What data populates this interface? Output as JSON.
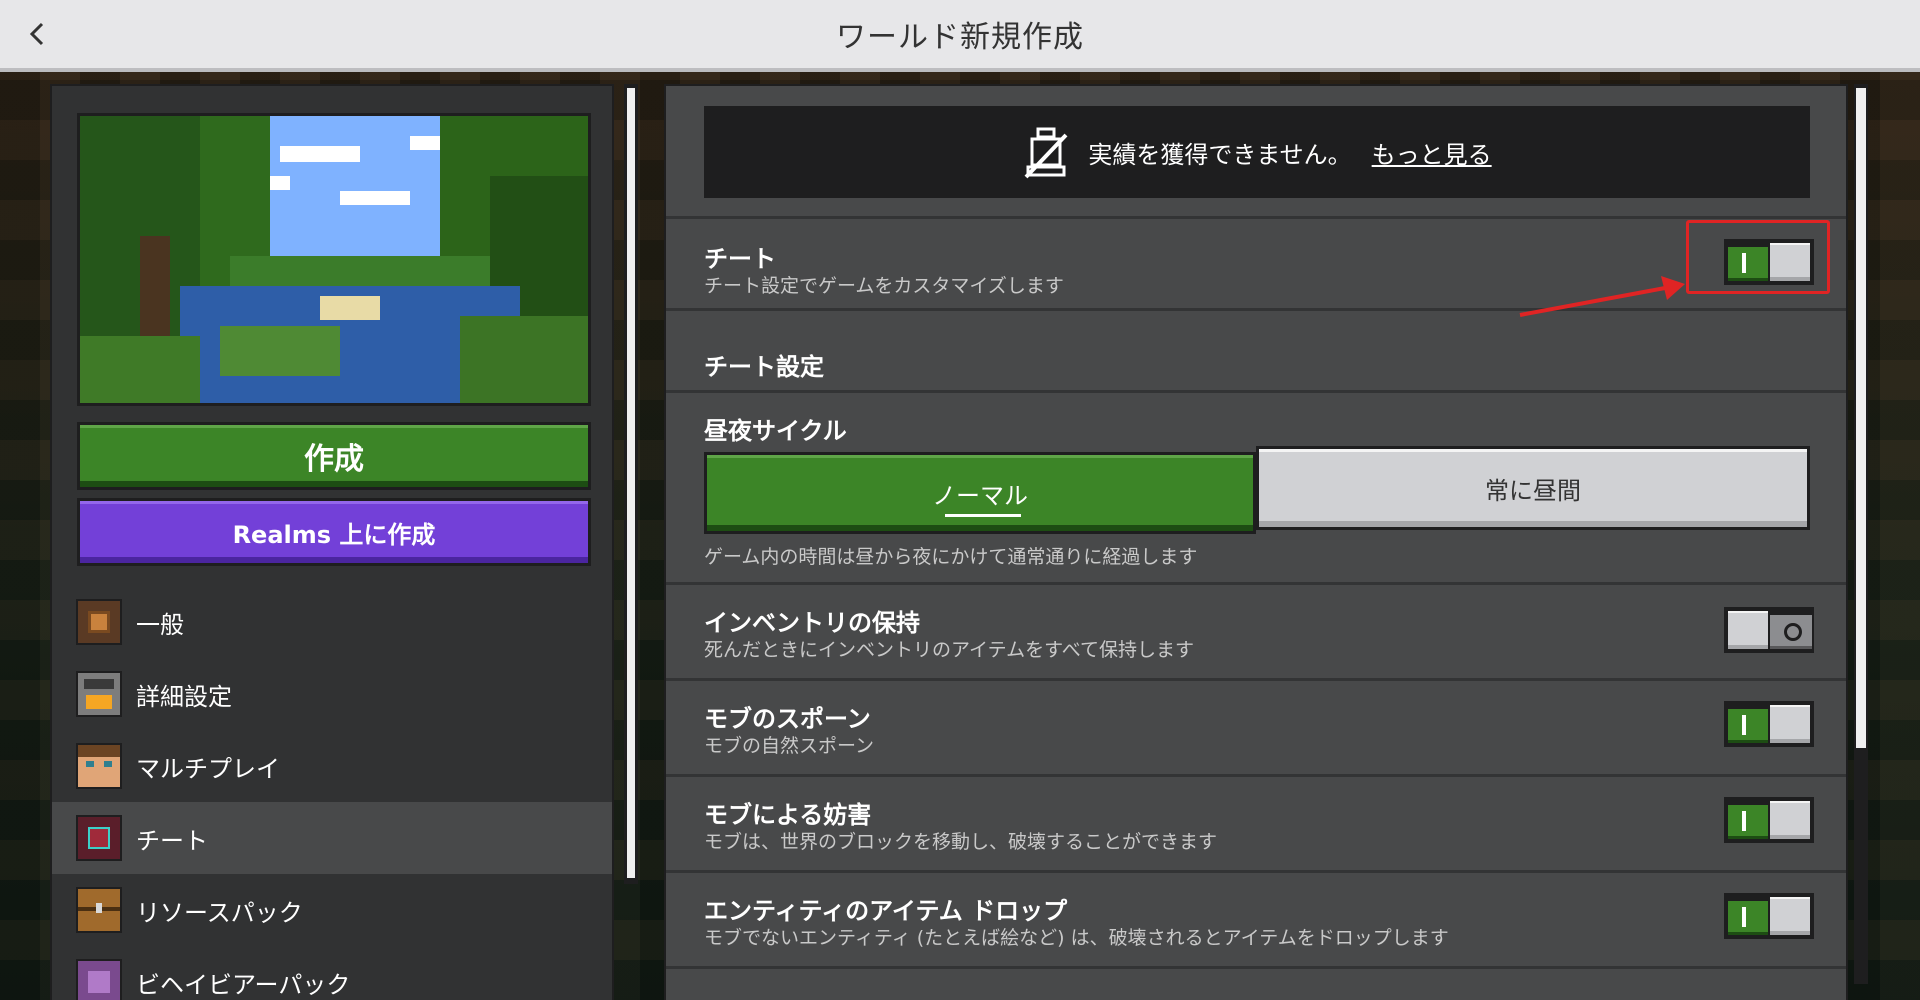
{
  "titlebar": {
    "title": "ワールド新規作成",
    "back_icon": "chevron-left-icon"
  },
  "left": {
    "create_label": "作成",
    "realms_label": "Realms 上に作成",
    "nav": [
      {
        "label": "一般",
        "icon": "gear-icon",
        "active": false
      },
      {
        "label": "詳細設定",
        "icon": "furnace-icon",
        "active": false
      },
      {
        "label": "マルチプレイ",
        "icon": "player-face-icon",
        "active": false
      },
      {
        "label": "チート",
        "icon": "command-block-icon",
        "active": true
      },
      {
        "label": "リソースパック",
        "icon": "chest-icon",
        "active": false
      },
      {
        "label": "ビヘイビアーパック",
        "icon": "behavior-pack-icon",
        "active": false
      }
    ]
  },
  "notice": {
    "text": "実績を獲得できません。",
    "link": "もっと見る",
    "icon": "crossed-trophy-icon"
  },
  "cheats": {
    "label": "チート",
    "desc": "チート設定でゲームをカスタマイズします",
    "enabled": true
  },
  "cheat_settings": {
    "heading": "チート設定"
  },
  "daylight": {
    "label": "昼夜サイクル",
    "options": [
      "ノーマル",
      "常に昼間"
    ],
    "selected": "ノーマル",
    "desc": "ゲーム内の時間は昼から夜にかけて通常通りに経過します"
  },
  "settings": [
    {
      "label": "インベントリの保持",
      "desc": "死んだときにインベントリのアイテムをすべて保持します",
      "enabled": false
    },
    {
      "label": "モブのスポーン",
      "desc": "モブの自然スポーン",
      "enabled": true
    },
    {
      "label": "モブによる妨害",
      "desc": "モブは、世界のブロックを移動し、破壊することができます",
      "enabled": true
    },
    {
      "label": "エンティティのアイテム ドロップ",
      "desc": "モブでないエンティティ (たとえば絵など) は、破壊されるとアイテムをドロップします",
      "enabled": true
    }
  ],
  "colors": {
    "accent_green": "#3c8527",
    "realms_purple": "#7340d8",
    "annotation_red": "#e02424"
  }
}
